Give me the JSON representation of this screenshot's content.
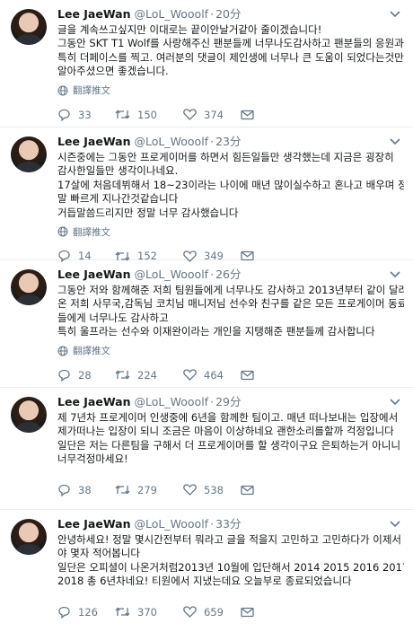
{
  "translate_label": "翻譯推文",
  "tweets": [
    {
      "name": "Lee JaeWan",
      "handle": "@LoL_Wooolf",
      "time": "20分",
      "lines": [
        "글을 계속쓰고싶지만 이대로는 끝이안날거같아 줄이겠습니다!",
        "그동안 SKT T1 Wolf를 사랑해주신 팬분들께 너무나도감사하고 팬분들의 응원과",
        "특히 더페이스를 찍고. 여러분의 댓글이 제인생에 너무나 큰 도움이 되었다는것만",
        "알아주셨으면 좋겠습니다."
      ],
      "replies": "33",
      "retweets": "150",
      "likes": "374"
    },
    {
      "name": "Lee JaeWan",
      "handle": "@LoL_Wooolf",
      "time": "23分",
      "lines": [
        "시즌중에는 그동안 프로게이머를 하면서 힘든일들만 생각했는데 지금은 굉장히",
        "감사한일들만 생각이나네요.",
        "17살에 처음데뷔해서 18~23이라는 나이에 매년 많이실수하고 혼나고 배우며 정",
        "말 빠르게 지나간것같습니다",
        "거듭말씀드리지만 정말 너무 감사했습니다"
      ],
      "replies": "14",
      "retweets": "152",
      "likes": "349"
    },
    {
      "name": "Lee JaeWan",
      "handle": "@LoL_Wooolf",
      "time": "26分",
      "lines": [
        "그동안 저와 함께해준 저희 팀원들에게 너무나도 감사하고 2013년부터 같이 달려",
        "온 저희 사무국,감독님 코치님 매니저님 선수와 친구를 같은 모든 프로게이머 동료",
        "들에게 너무나도 감사하고",
        "특히 울프라는 선수와 이재완이라는 개인을 지탱해준 팬분들께 감사합니다"
      ],
      "replies": "28",
      "retweets": "224",
      "likes": "464"
    },
    {
      "name": "Lee JaeWan",
      "handle": "@LoL_Wooolf",
      "time": "29分",
      "lines": [
        "제 7년차 프로게이머 인생중에 6년을 함께한 팀이고. 매년 떠나보내는 입장에서",
        "제가떠나는 입장이 되니 조금은 마음이 이상하네요 괜한소리를할까 걱정입니다",
        "일단은 저는 다른팀을 구해서 더 프로게이머를 할 생각이구요 은퇴하는거 아니니",
        "너무걱정마세요!"
      ],
      "replies": "38",
      "retweets": "279",
      "likes": "538"
    },
    {
      "name": "Lee JaeWan",
      "handle": "@LoL_Wooolf",
      "time": "33分",
      "lines": [
        "안녕하세요! 정말 몇시간전부터 뭐라고 글을 적을지 고민하고 고민하다가 이제서",
        "야 몇자 적어봅니다",
        "일단은 오피셜이 나온거처럼2013년 10월에 입단해서 2014 2015 2016 2017",
        "2018 총 6년차네요! 티원에서 지냈는데요 오늘부로 종료되었습니다"
      ],
      "replies": "126",
      "retweets": "370",
      "likes": "659"
    }
  ]
}
